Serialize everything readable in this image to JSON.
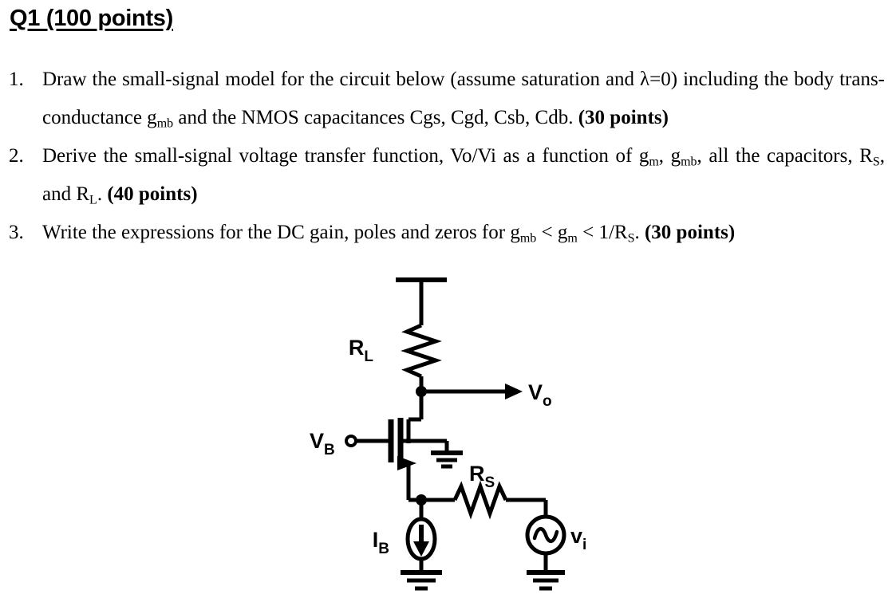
{
  "heading": "Q1 (100 points)",
  "questions": [
    {
      "number": "1.",
      "text_part1": "Draw the small-signal model for the circuit below (assume saturation and λ=0) including the body trans-conductance g",
      "sub1": "mb",
      "text_part2": " and the NMOS capacitances Cgs, Cgd, Csb, Cdb. ",
      "points": "(30 points)"
    },
    {
      "number": "2.",
      "text_part1": "Derive the small-signal voltage transfer function, Vo/Vi as a function of g",
      "sub1": "m",
      "text_part2": ", g",
      "sub2": "mb",
      "text_part3": ", all the capacitors, R",
      "sub3": "S",
      "text_part4": ", and R",
      "sub4": "L",
      "text_part5": ". ",
      "points": "(40 points)"
    },
    {
      "number": "3.",
      "text_part1": "Write the expressions for the DC gain, poles and zeros for g",
      "sub1": "mb",
      "text_part2": " < g",
      "sub2": "m",
      "text_part3": " < 1/R",
      "sub3": "S",
      "text_part4": ". ",
      "points": "(30 points)"
    }
  ],
  "circuit": {
    "labels": {
      "load_resistor": "R",
      "load_resistor_sub": "L",
      "source_resistor": "R",
      "source_resistor_sub": "S",
      "gate_bias": "V",
      "gate_bias_sub": "B",
      "output": "V",
      "output_sub": "o",
      "bias_current": "I",
      "bias_current_sub": "B",
      "input_source": "v",
      "input_source_sub": "i"
    },
    "ink_color": "#000000",
    "stroke_width": 5
  }
}
